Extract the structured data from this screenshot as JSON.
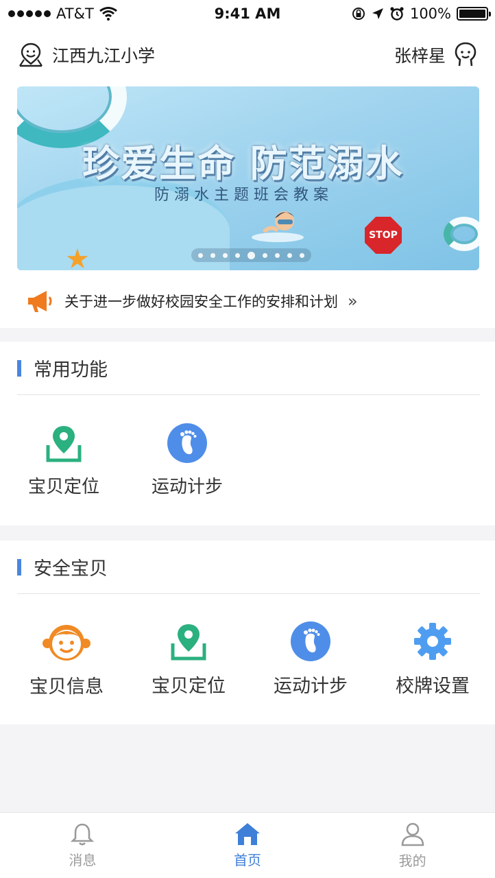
{
  "status_bar": {
    "carrier": "AT&T",
    "time": "9:41 AM",
    "battery": "100%",
    "icons": [
      "signal-icon",
      "wifi-icon",
      "orientation-lock-icon",
      "location-icon",
      "alarm-icon",
      "battery-icon"
    ]
  },
  "header": {
    "school": "江西九江小学",
    "user": "张梓星"
  },
  "banner": {
    "title": "珍爱生命 防范溺水",
    "subtitle": "防溺水主题班会教案",
    "stop_sign": "STOP",
    "page_count": 9,
    "active_page": 5
  },
  "notice": {
    "text": "关于进一步做好校园安全工作的安排和计划",
    "arrow": "»"
  },
  "section_common": {
    "title": "常用功能",
    "items": [
      {
        "label": "宝贝定位",
        "icon": "location-pin-icon"
      },
      {
        "label": "运动计步",
        "icon": "footprint-icon"
      }
    ]
  },
  "section_safety": {
    "title": "安全宝贝",
    "items": [
      {
        "label": "宝贝信息",
        "icon": "child-face-icon"
      },
      {
        "label": "宝贝定位",
        "icon": "location-pin-icon"
      },
      {
        "label": "运动计步",
        "icon": "footprint-icon"
      },
      {
        "label": "校牌设置",
        "icon": "gear-icon"
      }
    ]
  },
  "tabbar": {
    "items": [
      {
        "label": "消息",
        "icon": "bell-icon"
      },
      {
        "label": "首页",
        "icon": "home-icon",
        "active": true
      },
      {
        "label": "我的",
        "icon": "person-icon"
      }
    ]
  },
  "colors": {
    "accent": "#3e7fd8",
    "section_bar": "#4a86de",
    "green": "#2bb07f",
    "orange": "#f08a24",
    "blue_icon": "#4f8ee8"
  }
}
